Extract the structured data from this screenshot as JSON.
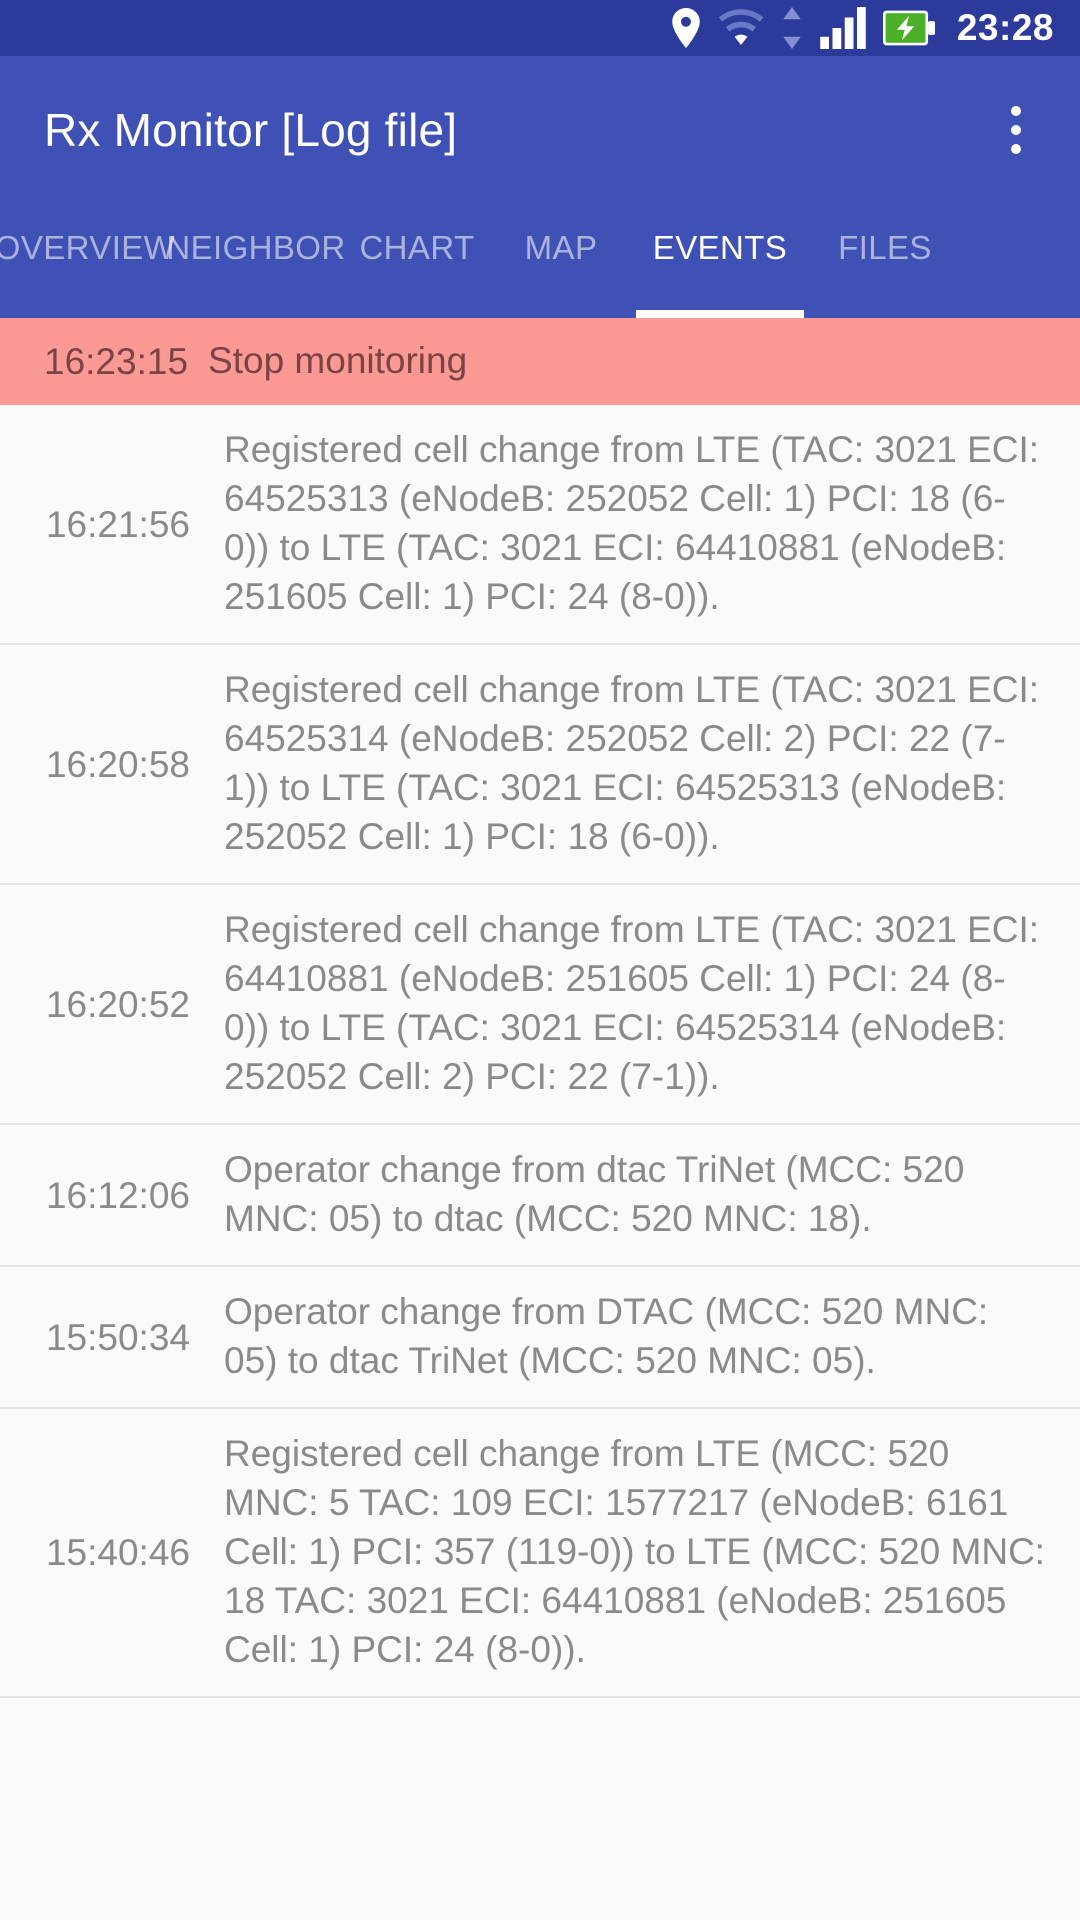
{
  "status_bar": {
    "time": "23:28",
    "icons": [
      {
        "name": "location-pin-icon"
      },
      {
        "name": "wifi-icon"
      },
      {
        "name": "data-transfer-arrows-icon"
      },
      {
        "name": "cellular-signal-icon"
      },
      {
        "name": "battery-charging-icon"
      }
    ],
    "background_color": "#2b3a9b"
  },
  "app_bar": {
    "title": "Rx Monitor [Log file]",
    "overflow_menu_label": "more-options",
    "background_color": "#3f51b5"
  },
  "tabs": {
    "selected_index": 4,
    "items": [
      {
        "label": "OVERVIEW"
      },
      {
        "label": "NEIGHBOR"
      },
      {
        "label": "CHART"
      },
      {
        "label": "MAP"
      },
      {
        "label": "EVENTS"
      },
      {
        "label": "FILES"
      }
    ],
    "indicator_color": "#ffffff"
  },
  "events": {
    "highlight_color": "#fb9a95",
    "rows": [
      {
        "time": "16:23:15",
        "text": "Stop monitoring",
        "highlight": true
      },
      {
        "time": "16:21:56",
        "text": "Registered cell change from LTE (TAC: 3021 ECI: 64525313 (eNodeB: 252052 Cell: 1) PCI: 18 (6-0)) to LTE (TAC: 3021 ECI: 64410881 (eNodeB: 251605 Cell: 1) PCI: 24 (8-0)).",
        "highlight": false
      },
      {
        "time": "16:20:58",
        "text": "Registered cell change from LTE (TAC: 3021 ECI: 64525314 (eNodeB: 252052 Cell: 2) PCI: 22 (7-1)) to LTE (TAC: 3021 ECI: 64525313 (eNodeB: 252052 Cell: 1) PCI: 18 (6-0)).",
        "highlight": false
      },
      {
        "time": "16:20:52",
        "text": "Registered cell change from LTE (TAC: 3021 ECI: 64410881 (eNodeB: 251605 Cell: 1) PCI: 24 (8-0)) to LTE (TAC: 3021 ECI: 64525314 (eNodeB: 252052 Cell: 2) PCI: 22 (7-1)).",
        "highlight": false
      },
      {
        "time": "16:12:06",
        "text": "Operator change from dtac TriNet (MCC: 520 MNC: 05) to dtac (MCC: 520 MNC: 18).",
        "highlight": false
      },
      {
        "time": "15:50:34",
        "text": "Operator change from DTAC (MCC: 520 MNC: 05) to dtac TriNet (MCC: 520 MNC: 05).",
        "highlight": false
      },
      {
        "time": "15:40:46",
        "text": "Registered cell change from LTE (MCC: 520 MNC: 5 TAC: 109 ECI: 1577217 (eNodeB: 6161 Cell: 1) PCI: 357 (119-0)) to LTE (MCC: 520 MNC: 18 TAC: 3021 ECI: 64410881 (eNodeB: 251605 Cell: 1) PCI: 24 (8-0)).",
        "highlight": false
      }
    ]
  }
}
